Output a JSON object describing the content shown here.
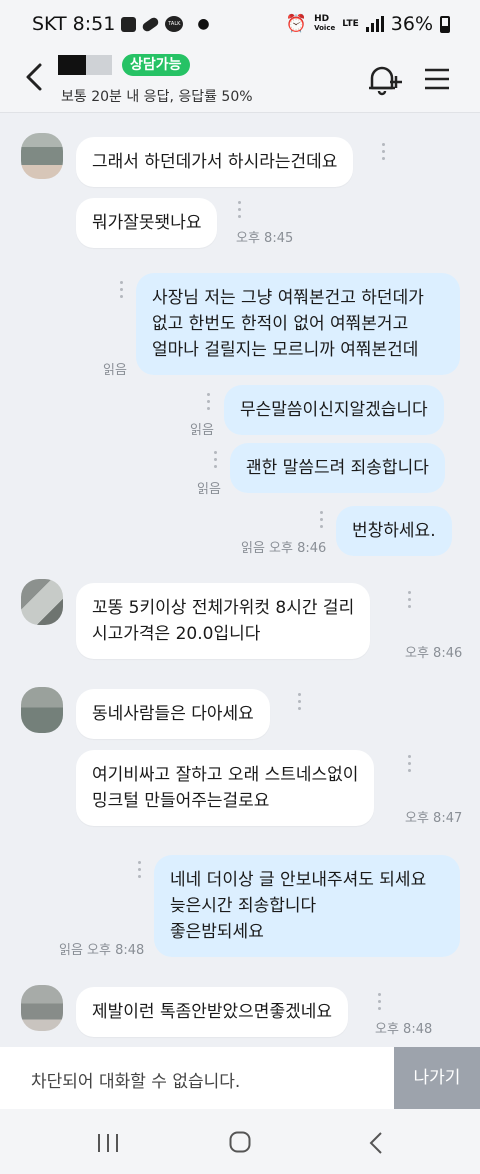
{
  "status_bar": {
    "carrier": "SKT",
    "time": "8:51",
    "talk_label": "TALK",
    "net_top": "HD",
    "net_bottom": "Voice",
    "lte": "LTE",
    "battery": "36%"
  },
  "header": {
    "badge": "상담가능",
    "subtitle": "보통 20분 내 응답, 응답률 50%"
  },
  "messages": [
    {
      "side": "in",
      "text": "그래서 하던데가서 하시라는건데요",
      "meta": ""
    },
    {
      "side": "in",
      "text": "뭐가잘못됏나요",
      "meta": "오후 8:45"
    },
    {
      "side": "out",
      "text": "사장님 저는 그냥 여쭤본건고 하던데가\n없고 한번도 한적이 없어 여쭤본거고\n얼마나 걸릴지는 모르니까 여쭤본건데",
      "meta": "읽음"
    },
    {
      "side": "out",
      "text": "무슨말씀이신지알겠습니다",
      "meta": "읽음"
    },
    {
      "side": "out",
      "text": "괜한 말씀드려 죄송합니다",
      "meta": "읽음"
    },
    {
      "side": "out",
      "text": "번창하세요.",
      "meta": "읽음 오후 8:46"
    },
    {
      "side": "in",
      "text": "꼬똥 5키이상 전체가위컷 8시간 걸리\n시고가격은 20.0입니다",
      "meta": "오후 8:46"
    },
    {
      "side": "in",
      "text": "동네사람들은 다아세요",
      "meta": ""
    },
    {
      "side": "in",
      "text": "여기비싸고 잘하고 오래 스트네스없이\n밍크털 만들어주는걸로요",
      "meta": "오후 8:47"
    },
    {
      "side": "out",
      "text": "네네 더이상 글 안보내주셔도 되세요\n늦은시간 죄송합니다\n좋은밤되세요",
      "meta": "읽음 오후 8:48"
    },
    {
      "side": "in",
      "text": "제발이런 톡좀안받았으면좋겠네요",
      "meta": "오후 8:48"
    }
  ],
  "footer": {
    "blocked_text": "차단되어 대화할 수 없습니다.",
    "leave_button": "나가기"
  },
  "colors": {
    "accent_badge": "#26c265",
    "outgoing_bubble": "#dcefff",
    "incoming_bubble": "#ffffff",
    "background": "#eef0f4"
  }
}
